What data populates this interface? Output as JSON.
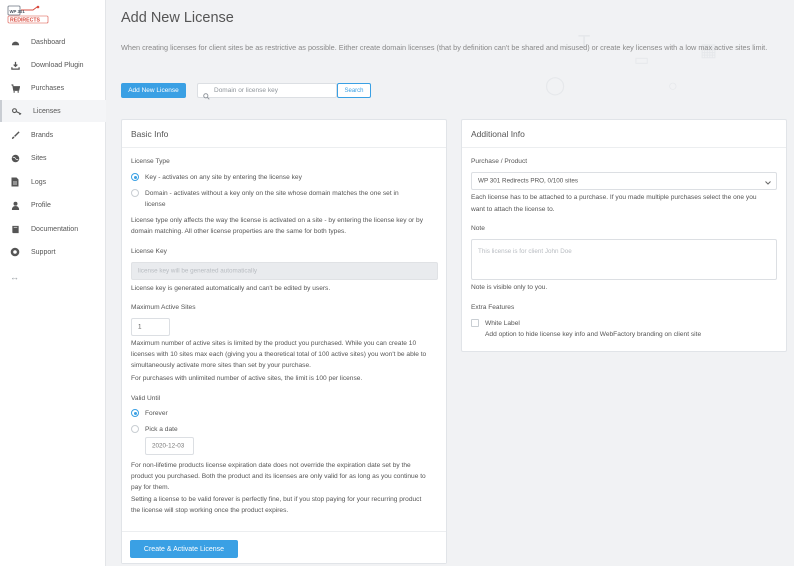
{
  "brand": {
    "logo_line1": "WP 301",
    "logo_line2": "REDIRECTS"
  },
  "sidebar": {
    "items": [
      {
        "label": "Dashboard",
        "icon": "dashboard-icon"
      },
      {
        "label": "Download Plugin",
        "icon": "download-icon"
      },
      {
        "label": "Purchases",
        "icon": "cart-icon"
      },
      {
        "label": "Licenses",
        "icon": "key-icon",
        "active": true
      },
      {
        "label": "Brands",
        "icon": "brush-icon"
      },
      {
        "label": "Sites",
        "icon": "globe-icon"
      },
      {
        "label": "Logs",
        "icon": "document-icon"
      },
      {
        "label": "Profile",
        "icon": "user-icon"
      },
      {
        "label": "Documentation",
        "icon": "book-icon"
      },
      {
        "label": "Support",
        "icon": "lifebuoy-icon"
      }
    ],
    "collapse_glyph": "↔"
  },
  "header": {
    "title": "Add New License",
    "intro": "When creating licenses for client sites be as restrictive as possible. Either create domain licenses (that by definition can't be shared and misused) or create key licenses with a low max active sites limit.",
    "add_button": "Add New License",
    "search_placeholder": "Domain or license key",
    "search_button": "Search"
  },
  "basic_info": {
    "title": "Basic Info",
    "license_type_label": "License Type",
    "option_key": "Key - activates on any site by entering the license key",
    "option_domain_line1": "Domain - activates without a key only on the site whose domain matches the one set in",
    "option_domain_line2": "license",
    "license_type_help_1": "License type only affects the way the license is activated on a site - by entering the license key or by",
    "license_type_help_2": "domain matching. All other license properties are the same for both types.",
    "license_key_label": "License Key",
    "license_key_placeholder": "license key will be generated automatically",
    "license_key_help": "License key is generated automatically and can't be edited by users.",
    "max_sites_label": "Maximum Active Sites",
    "max_sites_value": "1",
    "max_sites_help_1": "Maximum number of active sites is limited by the product you purchased. While you can create 10",
    "max_sites_help_2": "licenses with 10 sites max each (giving you a theoretical total of 100 active sites) you won't be able to",
    "max_sites_help_3": "simultaneously activate more sites than set by your purchase.",
    "max_sites_help_4": "For purchases with unlimited number of active sites, the limit is 100 per license.",
    "valid_until_label": "Valid Until",
    "option_forever": "Forever",
    "option_pick_date": "Pick a date",
    "date_value": "2020-12-03",
    "valid_help_1": "For non-lifetime products license expiration date does not override the expiration date set by the",
    "valid_help_2": "product you purchased. Both the product and its licenses are only valid for as long as you continue to",
    "valid_help_3": "pay for them.",
    "valid_help_4": "Setting a license to be valid forever is perfectly fine, but if you stop paying for your recurring product",
    "valid_help_5": "the license will stop working once the product expires.",
    "submit_button": "Create & Activate License"
  },
  "additional_info": {
    "title": "Additional Info",
    "purchase_label": "Purchase / Product",
    "purchase_value": "WP 301 Redirects PRO, 0/100 sites",
    "purchase_help_1": "Each license has to be attached to a purchase. If you made multiple purchases select the one you",
    "purchase_help_2": "want to attach the license to.",
    "note_label": "Note",
    "note_placeholder": "This license is for client John Doe",
    "note_help": "Note is visible only to you.",
    "extra_label": "Extra Features",
    "white_label": "White Label",
    "white_label_help": "Add option to hide license key info and WebFactory branding on client site"
  },
  "colors": {
    "accent": "#3aa0e4",
    "sidebar_bg": "#ffffff",
    "page_bg": "#f1f2f4"
  }
}
